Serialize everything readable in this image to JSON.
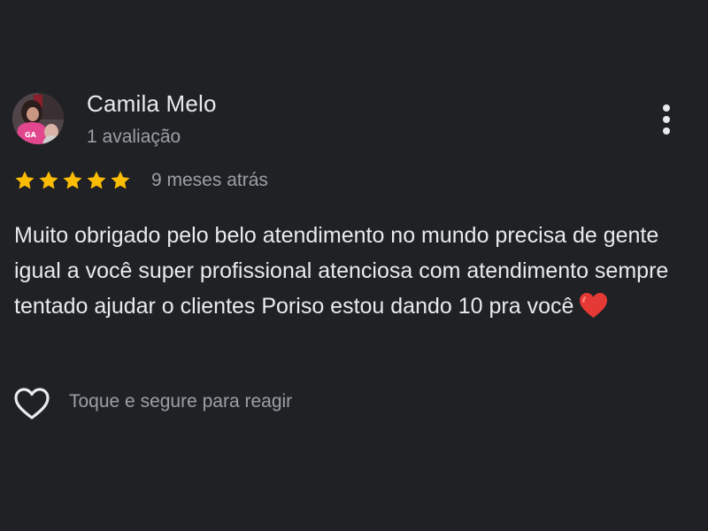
{
  "reviewer": {
    "name": "Camila Melo",
    "review_count": "1 avaliação",
    "avatar_icon": "profile-photo"
  },
  "rating": {
    "stars": 5,
    "max_stars": 5,
    "star_color": "#fbbc04"
  },
  "review": {
    "date": "9 meses atrás",
    "text": "Muito obrigado pelo belo atendimento no mundo precisa de gente igual a você super profissional atenciosa com atendimento sempre tentado ajudar o clientes Poriso estou dando 10 pra você",
    "emoji": "red-heart-emoji"
  },
  "actions": {
    "more_icon": "more-vertical-icon",
    "react_icon": "heart-outline-icon",
    "react_hint": "Toque e segure para reagir"
  },
  "colors": {
    "background": "#202124",
    "primary_text": "#e8eaed",
    "secondary_text": "#9aa0a6",
    "heart_red": "#e53935"
  }
}
